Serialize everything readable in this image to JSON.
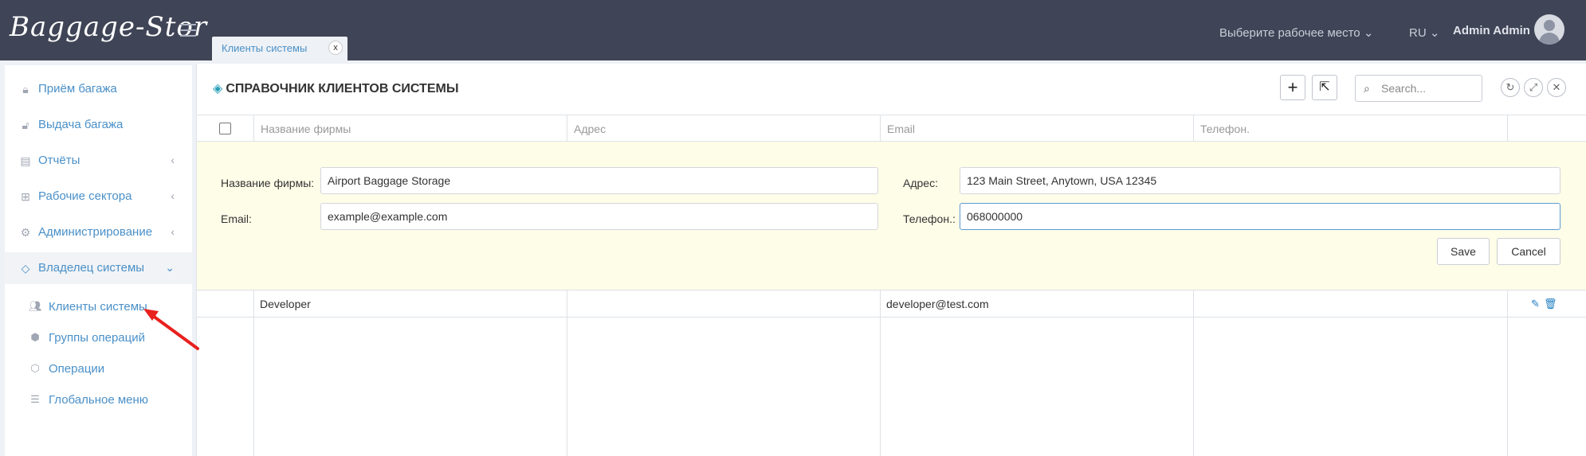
{
  "header": {
    "logo": "Baggage-Stor",
    "tab_label": "Клиенты системы",
    "tab_close": "x",
    "workspace": "Выберите рабочее место",
    "lang": "RU",
    "user_name": "Admin Admin"
  },
  "sidebar": {
    "items": [
      {
        "label": "Приём багажа",
        "icon": "lock-icon"
      },
      {
        "label": "Выдача багажа",
        "icon": "unlock-icon"
      },
      {
        "label": "Отчёты",
        "icon": "report-icon"
      },
      {
        "label": "Рабочие сектора",
        "icon": "sitemap-icon"
      },
      {
        "label": "Администрирование",
        "icon": "gear-icon"
      },
      {
        "label": "Владелец системы",
        "icon": "diamond-icon"
      }
    ],
    "sub_items": [
      {
        "label": "Клиенты системы",
        "icon": "users-icon"
      },
      {
        "label": "Группы операций",
        "icon": "cube-icon"
      },
      {
        "label": "Операции",
        "icon": "cubes-icon"
      },
      {
        "label": "Глобальное меню",
        "icon": "list-icon"
      }
    ]
  },
  "panel": {
    "title": "СПРАВОЧНИК КЛИЕНТОВ СИСТЕМЫ",
    "search_placeholder": "Search..."
  },
  "table": {
    "columns": [
      "Название фирмы",
      "Адрес",
      "Email",
      "Телефон."
    ],
    "rows": [
      {
        "name": "Developer",
        "address": "",
        "email": "developer@test.com",
        "phone": ""
      }
    ]
  },
  "form": {
    "name_label": "Название фирмы:",
    "name_value": "Airport Baggage Storage",
    "address_label": "Адрес:",
    "address_value": "123 Main Street, Anytown, USA 12345",
    "email_label": "Email:",
    "email_value": "example@example.com",
    "phone_label": "Телефон.:",
    "phone_value": "068000000",
    "save_label": "Save",
    "cancel_label": "Cancel"
  }
}
